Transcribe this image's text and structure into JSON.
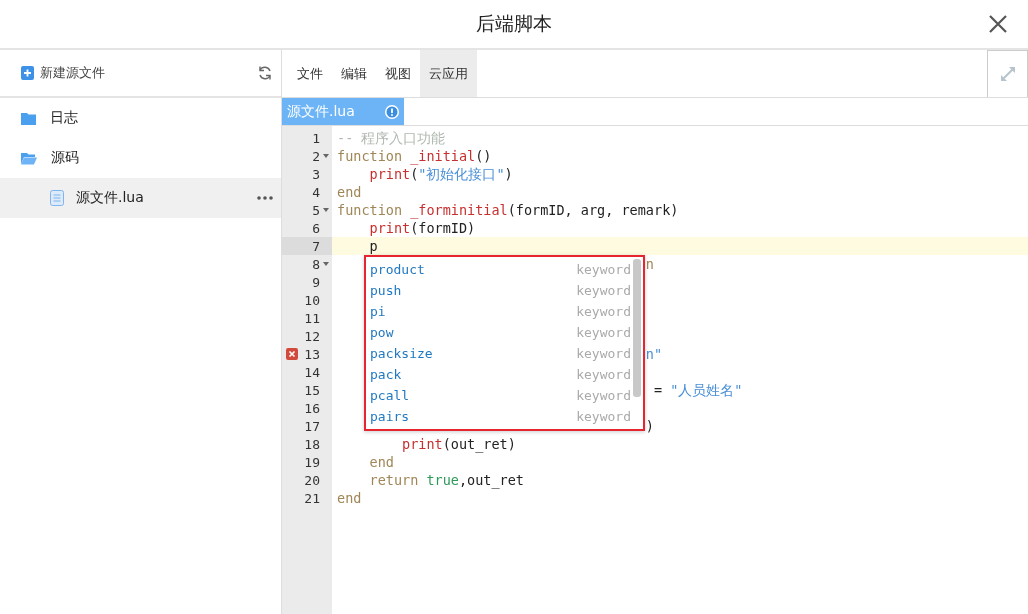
{
  "window": {
    "title": "后端脚本"
  },
  "sidebar": {
    "new_file": "新建源文件",
    "tree": [
      {
        "label": "日志",
        "kind": "folder",
        "expanded": false,
        "selected": false
      },
      {
        "label": "源码",
        "kind": "folder",
        "expanded": true,
        "selected": false,
        "children": [
          {
            "label": "源文件.lua",
            "kind": "file",
            "selected": true
          }
        ]
      }
    ]
  },
  "menu": [
    {
      "label": "文件",
      "selected": false
    },
    {
      "label": "编辑",
      "selected": false
    },
    {
      "label": "视图",
      "selected": false
    },
    {
      "label": "云应用",
      "selected": true
    }
  ],
  "tabs": [
    {
      "label": "源文件.lua",
      "selected": true
    }
  ],
  "code": {
    "lines": [
      {
        "number": "1",
        "fold": false,
        "error": false,
        "active": false,
        "tokens": [
          {
            "kind": "comment",
            "text": "-- 程序入口功能"
          }
        ]
      },
      {
        "number": "2",
        "fold": true,
        "error": false,
        "active": false,
        "tokens": [
          {
            "kind": "keyword",
            "text": "function "
          },
          {
            "kind": "name",
            "text": "_initial"
          },
          {
            "kind": "plain",
            "text": "()"
          }
        ]
      },
      {
        "number": "3",
        "fold": false,
        "error": false,
        "active": false,
        "tokens": [
          {
            "kind": "name",
            "text": "    print"
          },
          {
            "kind": "plain",
            "text": "("
          },
          {
            "kind": "string",
            "text": "\"初始化接口\""
          },
          {
            "kind": "plain",
            "text": ")"
          }
        ]
      },
      {
        "number": "4",
        "fold": false,
        "error": false,
        "active": false,
        "tokens": [
          {
            "kind": "keyword",
            "text": "end"
          }
        ]
      },
      {
        "number": "5",
        "fold": true,
        "error": false,
        "active": false,
        "tokens": [
          {
            "kind": "keyword",
            "text": "function "
          },
          {
            "kind": "name",
            "text": "_forminitial"
          },
          {
            "kind": "plain",
            "text": "(formID, arg, remark)"
          }
        ]
      },
      {
        "number": "6",
        "fold": false,
        "error": false,
        "active": false,
        "tokens": [
          {
            "kind": "name",
            "text": "    print"
          },
          {
            "kind": "plain",
            "text": "(formID)"
          }
        ]
      },
      {
        "number": "7",
        "fold": false,
        "error": false,
        "active": true,
        "tokens": [
          {
            "kind": "plain",
            "text": "    p"
          }
        ]
      },
      {
        "number": "8",
        "fold": true,
        "error": false,
        "active": false,
        "tail": [
          {
            "kind": "keyword",
            "text": "n"
          }
        ]
      },
      {
        "number": "9",
        "fold": false,
        "error": false,
        "active": false
      },
      {
        "number": "10",
        "fold": false,
        "error": false,
        "active": false
      },
      {
        "number": "11",
        "fold": false,
        "error": false,
        "active": false
      },
      {
        "number": "12",
        "fold": false,
        "error": false,
        "active": false
      },
      {
        "number": "13",
        "fold": false,
        "error": true,
        "active": false,
        "tail": [
          {
            "kind": "string",
            "text": "n\""
          }
        ]
      },
      {
        "number": "14",
        "fold": false,
        "error": false,
        "active": false
      },
      {
        "number": "15",
        "fold": false,
        "error": false,
        "active": false,
        "tail": [
          {
            "kind": "plain",
            "text": " = "
          },
          {
            "kind": "string",
            "text": "\"人员姓名\""
          }
        ]
      },
      {
        "number": "16",
        "fold": false,
        "error": false,
        "active": false
      },
      {
        "number": "17",
        "fold": false,
        "error": false,
        "active": false,
        "tail": [
          {
            "kind": "plain",
            "text": ")"
          }
        ]
      },
      {
        "number": "18",
        "fold": false,
        "error": false,
        "active": false,
        "tokens": [
          {
            "kind": "name",
            "text": "        print"
          },
          {
            "kind": "plain",
            "text": "(out_ret)"
          }
        ]
      },
      {
        "number": "19",
        "fold": false,
        "error": false,
        "active": false,
        "tokens": [
          {
            "kind": "keyword",
            "text": "    end"
          }
        ]
      },
      {
        "number": "20",
        "fold": false,
        "error": false,
        "active": false,
        "tokens": [
          {
            "kind": "keyword",
            "text": "    return "
          },
          {
            "kind": "bool",
            "text": "true"
          },
          {
            "kind": "plain",
            "text": ",out_ret"
          }
        ]
      },
      {
        "number": "21",
        "fold": false,
        "error": false,
        "active": false,
        "tokens": [
          {
            "kind": "keyword",
            "text": "end"
          }
        ]
      }
    ]
  },
  "autocomplete": [
    {
      "word": "product",
      "type": "keyword",
      "selected": false
    },
    {
      "word": "push",
      "type": "keyword",
      "selected": false
    },
    {
      "word": "pi",
      "type": "keyword",
      "selected": false
    },
    {
      "word": "pow",
      "type": "keyword",
      "selected": false
    },
    {
      "word": "packsize",
      "type": "keyword",
      "selected": false
    },
    {
      "word": "pack",
      "type": "keyword",
      "selected": false
    },
    {
      "word": "pcall",
      "type": "keyword",
      "selected": false
    },
    {
      "word": "pairs",
      "type": "keyword",
      "selected": false
    }
  ]
}
